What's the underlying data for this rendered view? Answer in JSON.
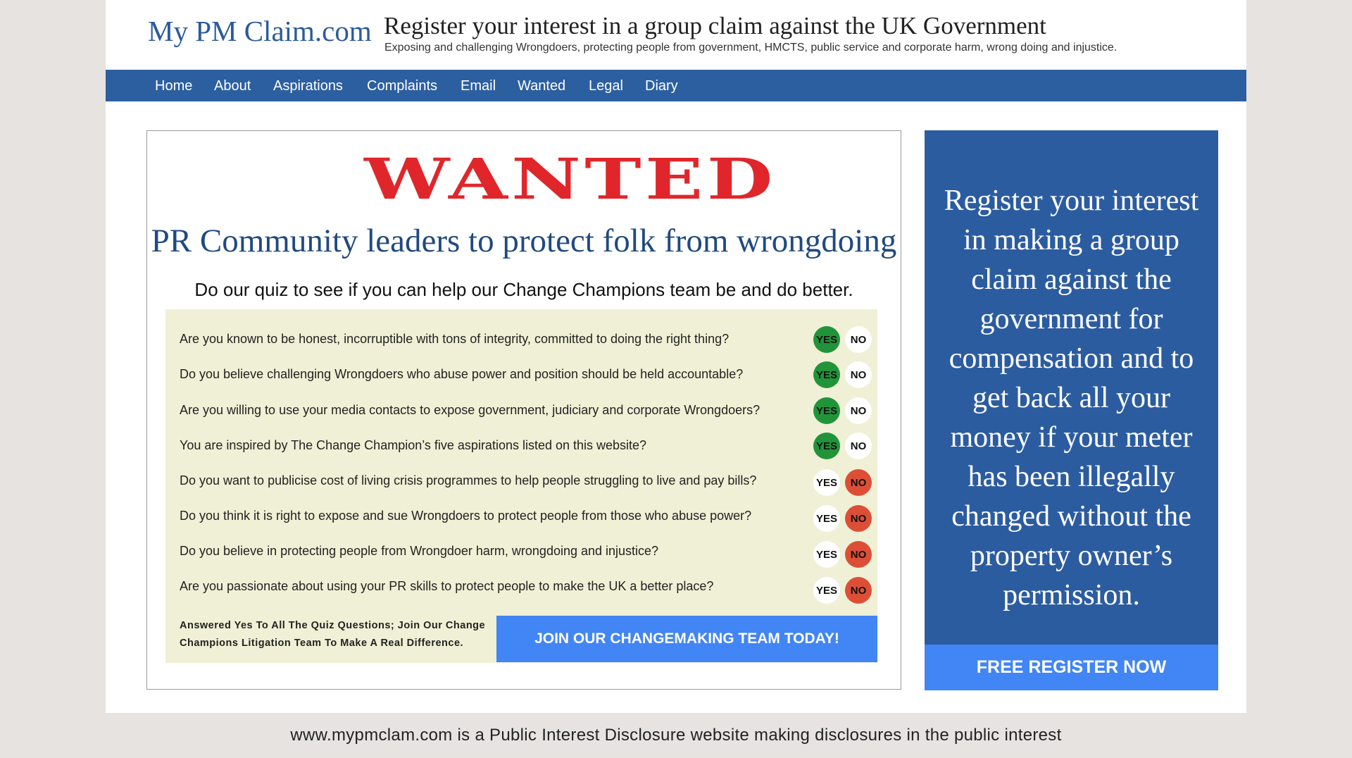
{
  "header": {
    "logo": "My PM Claim.com",
    "title": "Register your interest in a group claim against the UK Government",
    "tagline": "Exposing and challenging Wrongdoers, protecting people from government, HMCTS, public service and corporate harm, wrong doing and injustice."
  },
  "nav": {
    "items": [
      {
        "label": "Home"
      },
      {
        "label": "About"
      },
      {
        "label": "Aspirations"
      },
      {
        "label": "Complaints"
      },
      {
        "label": "Email"
      },
      {
        "label": "Wanted"
      },
      {
        "label": "Legal"
      },
      {
        "label": "Diary"
      }
    ]
  },
  "wanted": {
    "heading": "WANTED",
    "subheading": "PR Community leaders to protect folk from wrongdoing",
    "intro": "Do our quiz to see if you can help our Change Champions team be and do better."
  },
  "quiz": {
    "yes_label": "YES",
    "no_label": "NO",
    "questions": [
      {
        "text": "Are you known to be honest, incorruptible with tons of integrity, committed to doing the right thing?",
        "selected": "YES"
      },
      {
        "text": "Do you believe challenging Wrongdoers who abuse power and position should be held accountable?",
        "selected": "YES"
      },
      {
        "text": "Are you willing to use your media contacts to expose government, judiciary and corporate Wrongdoers?",
        "selected": "YES"
      },
      {
        "text": "You are inspired by The Change Champion’s five aspirations listed on this website?",
        "selected": "YES"
      },
      {
        "text": "Do you want to publicise cost of living crisis programmes to help people struggling to live and pay bills?",
        "selected": "NO"
      },
      {
        "text": "Do you think it is right to expose and sue Wrongdoers to protect people from those who abuse power?",
        "selected": "NO"
      },
      {
        "text": "Do you believe in protecting people from Wrongdoer harm, wrongdoing and injustice?",
        "selected": "NO"
      },
      {
        "text": "Are you passionate about using your PR skills to protect people to make the UK a better place?",
        "selected": "NO"
      }
    ],
    "footer_line1": "Answered Yes To All The Quiz Questions; Join Our Change",
    "footer_line2": "Champions Litigation Team To Make A Real Difference.",
    "join_button": "JOIN OUR CHANGEMAKING TEAM TODAY!"
  },
  "side": {
    "text": "Register your interest in making a group claim against the government for compensation and to get back all your money if your meter has been illegally changed without the property owner’s permission.",
    "button": "FREE REGISTER NOW"
  },
  "footer": {
    "text": "www.mypmclam.com is a Public Interest Disclosure website making disclosures in the public interest"
  },
  "colors": {
    "nav_bg": "#2c5fa0",
    "accent_blue": "#4285f4",
    "wanted_red": "#e0262b",
    "yes_green": "#21943a",
    "no_red": "#dc4f36",
    "quiz_bg": "#f0f0d6"
  }
}
